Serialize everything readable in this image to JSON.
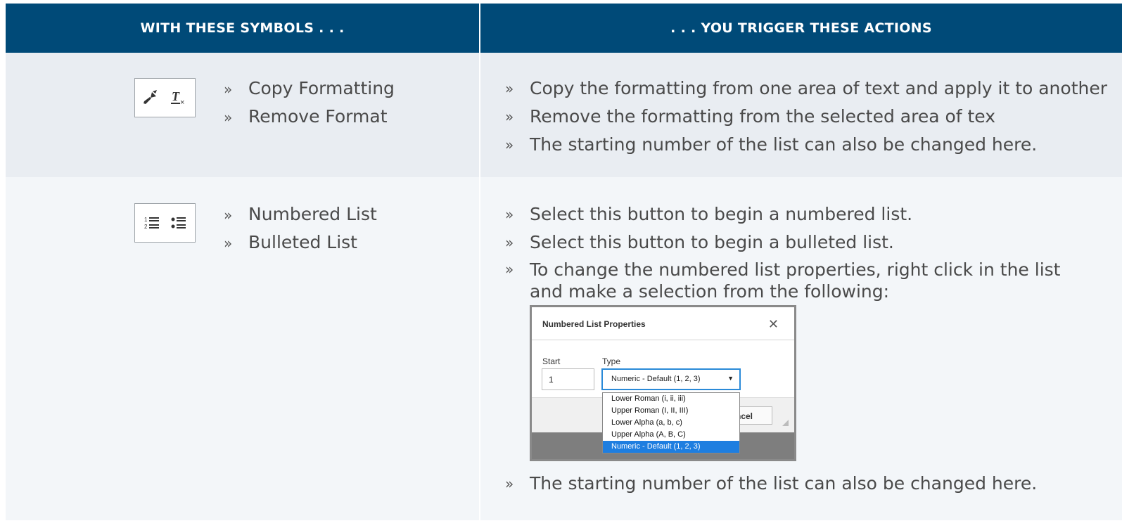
{
  "header": {
    "left": "WITH THESE SYMBOLS . . .",
    "right": ". . . YOU TRIGGER THESE ACTIONS"
  },
  "rows": [
    {
      "icons": [
        "paint-brush-icon",
        "remove-format-icon"
      ],
      "symbols": [
        "Copy Formatting",
        "Remove Format"
      ],
      "actions": [
        "Copy the formatting from one area of text and apply it to another",
        "Remove the formatting from the selected area of tex",
        "The starting number of the list can also be changed here."
      ]
    },
    {
      "icons": [
        "numbered-list-icon",
        "bulleted-list-icon"
      ],
      "symbols": [
        "Numbered List",
        "Bulleted List"
      ],
      "actions": [
        "Select this button to begin a numbered list.",
        "Select this button to begin a bulleted list.",
        "To change the numbered list properties, right click in the list and make a selection from the following:",
        "The starting number of the list can also be changed here."
      ]
    }
  ],
  "bullet": "»",
  "dialog": {
    "title": "Numbered List Properties",
    "close": "✕",
    "start_label": "Start",
    "start_value": "1",
    "type_label": "Type",
    "type_value": "Numeric - Default (1, 2, 3)",
    "type_arrow": "▼",
    "options": [
      "Lower Roman (i, ii, iii)",
      "Upper Roman (I, II, III)",
      "Lower Alpha (a, b, c)",
      "Upper Alpha (A, B, C)",
      "Numeric - Default (1, 2, 3)"
    ],
    "selected_option": "Numeric - Default (1, 2, 3)",
    "cancel_visible": "ncel"
  },
  "colors": {
    "header_bg": "#004a78",
    "row1_bg": "#e9edf2",
    "row2_bg": "#f3f6f9",
    "dropdown_selected": "#1e7ee0"
  }
}
